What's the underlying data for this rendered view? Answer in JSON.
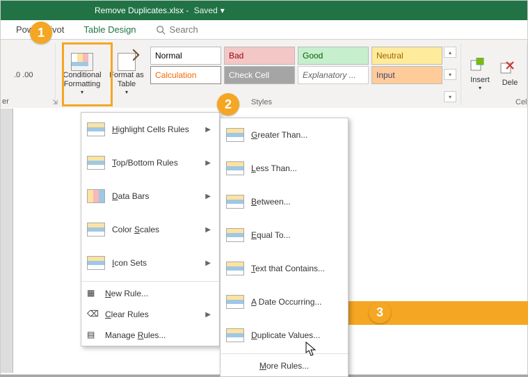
{
  "title": {
    "filename": "Remove Duplicates.xlsx",
    "status": "Saved"
  },
  "tabs": {
    "pivot": "Power Pivot",
    "design": "Table Design",
    "search": "Search"
  },
  "ribbon": {
    "cf_label": "Conditional\nFormatting",
    "fat_label": "Format as\nTable",
    "styles": {
      "normal": "Normal",
      "bad": "Bad",
      "good": "Good",
      "neutral": "Neutral",
      "calculation": "Calculation",
      "check": "Check Cell",
      "explan": "Explanatory ...",
      "input": "Input"
    },
    "insert": "Insert",
    "delete": "Dele",
    "group_styles": "Styles",
    "group_cells": "Cel"
  },
  "left_label": "er",
  "menu1": {
    "highlight": "Highlight Cells Rules",
    "topbottom": "Top/Bottom Rules",
    "databars": "Data Bars",
    "colorscales": "Color Scales",
    "iconsets": "Icon Sets",
    "newrule": "New Rule...",
    "clear": "Clear Rules",
    "manage": "Manage Rules..."
  },
  "menu2": {
    "gt": "Greater Than...",
    "lt": "Less Than...",
    "between": "Between...",
    "equal": "Equal To...",
    "text": "Text that Contains...",
    "date": "A Date Occurring...",
    "dup": "Duplicate Values...",
    "more": "More Rules..."
  },
  "badges": {
    "b1": "1",
    "b2": "2",
    "b3": "3"
  }
}
